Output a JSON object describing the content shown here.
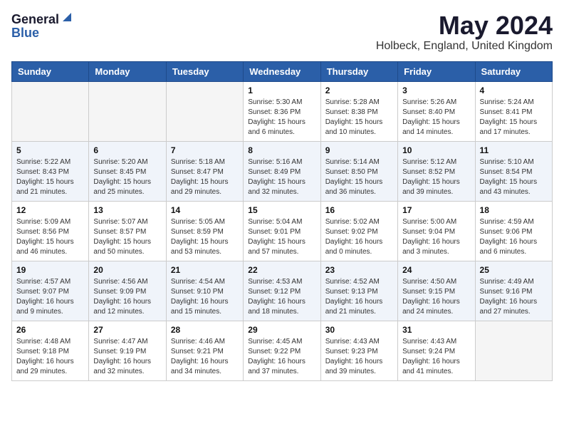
{
  "logo": {
    "general": "General",
    "blue": "Blue"
  },
  "title": {
    "month": "May 2024",
    "location": "Holbeck, England, United Kingdom"
  },
  "weekdays": [
    "Sunday",
    "Monday",
    "Tuesday",
    "Wednesday",
    "Thursday",
    "Friday",
    "Saturday"
  ],
  "weeks": [
    [
      {
        "day": "",
        "info": ""
      },
      {
        "day": "",
        "info": ""
      },
      {
        "day": "",
        "info": ""
      },
      {
        "day": "1",
        "info": "Sunrise: 5:30 AM\nSunset: 8:36 PM\nDaylight: 15 hours\nand 6 minutes."
      },
      {
        "day": "2",
        "info": "Sunrise: 5:28 AM\nSunset: 8:38 PM\nDaylight: 15 hours\nand 10 minutes."
      },
      {
        "day": "3",
        "info": "Sunrise: 5:26 AM\nSunset: 8:40 PM\nDaylight: 15 hours\nand 14 minutes."
      },
      {
        "day": "4",
        "info": "Sunrise: 5:24 AM\nSunset: 8:41 PM\nDaylight: 15 hours\nand 17 minutes."
      }
    ],
    [
      {
        "day": "5",
        "info": "Sunrise: 5:22 AM\nSunset: 8:43 PM\nDaylight: 15 hours\nand 21 minutes."
      },
      {
        "day": "6",
        "info": "Sunrise: 5:20 AM\nSunset: 8:45 PM\nDaylight: 15 hours\nand 25 minutes."
      },
      {
        "day": "7",
        "info": "Sunrise: 5:18 AM\nSunset: 8:47 PM\nDaylight: 15 hours\nand 29 minutes."
      },
      {
        "day": "8",
        "info": "Sunrise: 5:16 AM\nSunset: 8:49 PM\nDaylight: 15 hours\nand 32 minutes."
      },
      {
        "day": "9",
        "info": "Sunrise: 5:14 AM\nSunset: 8:50 PM\nDaylight: 15 hours\nand 36 minutes."
      },
      {
        "day": "10",
        "info": "Sunrise: 5:12 AM\nSunset: 8:52 PM\nDaylight: 15 hours\nand 39 minutes."
      },
      {
        "day": "11",
        "info": "Sunrise: 5:10 AM\nSunset: 8:54 PM\nDaylight: 15 hours\nand 43 minutes."
      }
    ],
    [
      {
        "day": "12",
        "info": "Sunrise: 5:09 AM\nSunset: 8:56 PM\nDaylight: 15 hours\nand 46 minutes."
      },
      {
        "day": "13",
        "info": "Sunrise: 5:07 AM\nSunset: 8:57 PM\nDaylight: 15 hours\nand 50 minutes."
      },
      {
        "day": "14",
        "info": "Sunrise: 5:05 AM\nSunset: 8:59 PM\nDaylight: 15 hours\nand 53 minutes."
      },
      {
        "day": "15",
        "info": "Sunrise: 5:04 AM\nSunset: 9:01 PM\nDaylight: 15 hours\nand 57 minutes."
      },
      {
        "day": "16",
        "info": "Sunrise: 5:02 AM\nSunset: 9:02 PM\nDaylight: 16 hours\nand 0 minutes."
      },
      {
        "day": "17",
        "info": "Sunrise: 5:00 AM\nSunset: 9:04 PM\nDaylight: 16 hours\nand 3 minutes."
      },
      {
        "day": "18",
        "info": "Sunrise: 4:59 AM\nSunset: 9:06 PM\nDaylight: 16 hours\nand 6 minutes."
      }
    ],
    [
      {
        "day": "19",
        "info": "Sunrise: 4:57 AM\nSunset: 9:07 PM\nDaylight: 16 hours\nand 9 minutes."
      },
      {
        "day": "20",
        "info": "Sunrise: 4:56 AM\nSunset: 9:09 PM\nDaylight: 16 hours\nand 12 minutes."
      },
      {
        "day": "21",
        "info": "Sunrise: 4:54 AM\nSunset: 9:10 PM\nDaylight: 16 hours\nand 15 minutes."
      },
      {
        "day": "22",
        "info": "Sunrise: 4:53 AM\nSunset: 9:12 PM\nDaylight: 16 hours\nand 18 minutes."
      },
      {
        "day": "23",
        "info": "Sunrise: 4:52 AM\nSunset: 9:13 PM\nDaylight: 16 hours\nand 21 minutes."
      },
      {
        "day": "24",
        "info": "Sunrise: 4:50 AM\nSunset: 9:15 PM\nDaylight: 16 hours\nand 24 minutes."
      },
      {
        "day": "25",
        "info": "Sunrise: 4:49 AM\nSunset: 9:16 PM\nDaylight: 16 hours\nand 27 minutes."
      }
    ],
    [
      {
        "day": "26",
        "info": "Sunrise: 4:48 AM\nSunset: 9:18 PM\nDaylight: 16 hours\nand 29 minutes."
      },
      {
        "day": "27",
        "info": "Sunrise: 4:47 AM\nSunset: 9:19 PM\nDaylight: 16 hours\nand 32 minutes."
      },
      {
        "day": "28",
        "info": "Sunrise: 4:46 AM\nSunset: 9:21 PM\nDaylight: 16 hours\nand 34 minutes."
      },
      {
        "day": "29",
        "info": "Sunrise: 4:45 AM\nSunset: 9:22 PM\nDaylight: 16 hours\nand 37 minutes."
      },
      {
        "day": "30",
        "info": "Sunrise: 4:43 AM\nSunset: 9:23 PM\nDaylight: 16 hours\nand 39 minutes."
      },
      {
        "day": "31",
        "info": "Sunrise: 4:43 AM\nSunset: 9:24 PM\nDaylight: 16 hours\nand 41 minutes."
      },
      {
        "day": "",
        "info": ""
      }
    ]
  ]
}
